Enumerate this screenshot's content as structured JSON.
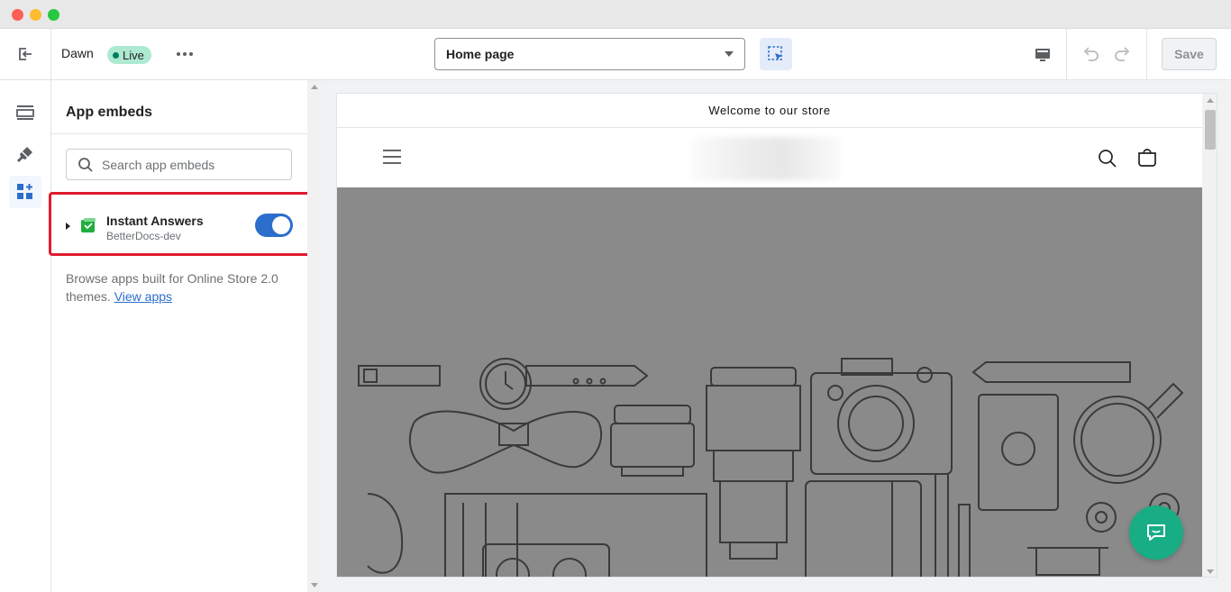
{
  "window": {
    "controls": [
      "close",
      "minimize",
      "maximize"
    ]
  },
  "topbar": {
    "theme_name": "Dawn",
    "status_badge": "Live",
    "page_select": {
      "value": "Home page"
    },
    "save_label": "Save"
  },
  "left_nav": {
    "items": [
      {
        "icon": "sections-icon"
      },
      {
        "icon": "theme-settings-icon"
      },
      {
        "icon": "app-embeds-icon",
        "active": true
      }
    ]
  },
  "panel": {
    "title": "App embeds",
    "search": {
      "placeholder": "Search app embeds",
      "value": ""
    },
    "embeds": [
      {
        "name": "Instant Answers",
        "app": "BetterDocs-dev",
        "enabled": true
      }
    ],
    "browse_text": "Browse apps built for Online Store 2.0 themes.",
    "browse_link": "View apps"
  },
  "preview": {
    "announcement": "Welcome to our store"
  },
  "colors": {
    "accent": "#2c6ecb",
    "highlight": "#e01b2e",
    "live_badge": "#aee9d1",
    "chat": "#18ad85",
    "hero_bg": "#8a8a8a"
  }
}
